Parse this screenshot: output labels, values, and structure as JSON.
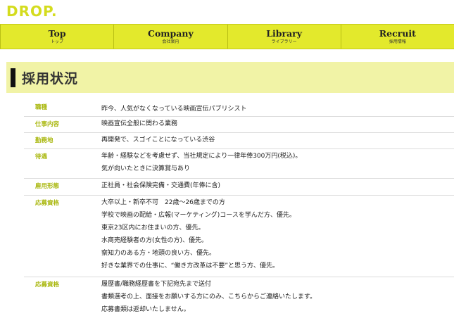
{
  "brand": {
    "logo": "DROP."
  },
  "nav": [
    {
      "main": "Top",
      "sub": "トップ"
    },
    {
      "main": "Company",
      "sub": "会社案内"
    },
    {
      "main": "Library",
      "sub": "ライブラリー"
    },
    {
      "main": "Recruit",
      "sub": "採用情報"
    }
  ],
  "heading": {
    "title": "採用状況"
  },
  "rows": [
    {
      "label": "職種",
      "values": [
        "昨今、人気がなくなっている映画宣伝パブリシスト"
      ]
    },
    {
      "label": "仕事内容",
      "values": [
        "映画宣伝全般に関わる業務"
      ]
    },
    {
      "label": "勤務地",
      "values": [
        "再開発で、スゴイことになっている渋谷"
      ]
    },
    {
      "label": "待遇",
      "values": [
        "年齢・経験などを考慮せず、当社規定により一律年俸300万円(税込)。",
        "気が向いたときに決算賞与あり"
      ]
    },
    {
      "label": "雇用形態",
      "values": [
        "正社員・社会保険完備・交通費(年俸に含)"
      ]
    },
    {
      "label": "応募資格",
      "values": [
        "大卒以上・新卒不可　22歳〜26歳までの方",
        "学校で映画の配給・広報(マーケティング)コースを学んだ方、優先。",
        "東京23区内にお住まいの方、優先。",
        "水商売経験者の方(女性の方)、優先。",
        "察知力のある方・地頭の良い方、優先。",
        "好きな業界での仕事に、“働き方改革は不要”と思う方、優先。"
      ]
    },
    {
      "label": "応募資格",
      "values": [
        "履歴書/職務経歴書を下記宛先まで送付",
        "書類選考の上、面接をお願いする方にのみ、こちらからご連絡いたします。",
        "応募書類は返却いたしません。"
      ]
    }
  ],
  "colors": {
    "accent": "#e3e92c",
    "label": "#aab810",
    "heading_bg": "#f1f3a6"
  }
}
